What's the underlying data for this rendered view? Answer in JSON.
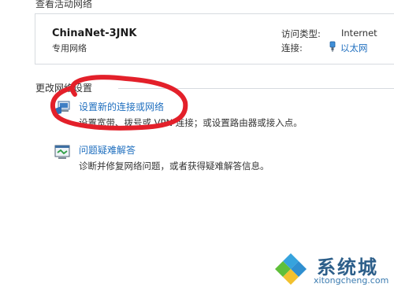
{
  "active_networks": {
    "header": "查看活动网络",
    "network": {
      "name": "ChinaNet-3JNK",
      "type": "专用网络",
      "access_label": "访问类型:",
      "access_value": "Internet",
      "connection_label": "连接:",
      "connection_value": "以太网"
    }
  },
  "change_settings": {
    "header": "更改网络设置",
    "tasks": [
      {
        "icon": "network-setup-icon",
        "link": "设置新的连接或网络",
        "description": "设置宽带、拨号或 VPN 连接；或设置路由器或接入点。"
      },
      {
        "icon": "troubleshoot-icon",
        "link": "问题疑难解答",
        "description": "诊断并修复网络问题，或者获得疑难解答信息。"
      }
    ]
  },
  "watermark": {
    "brand": "系统城",
    "domain": "xitongcheng.com"
  },
  "colors": {
    "link": "#1f6fbf",
    "annotation": "#e3202a",
    "border": "#d7dbe0"
  }
}
